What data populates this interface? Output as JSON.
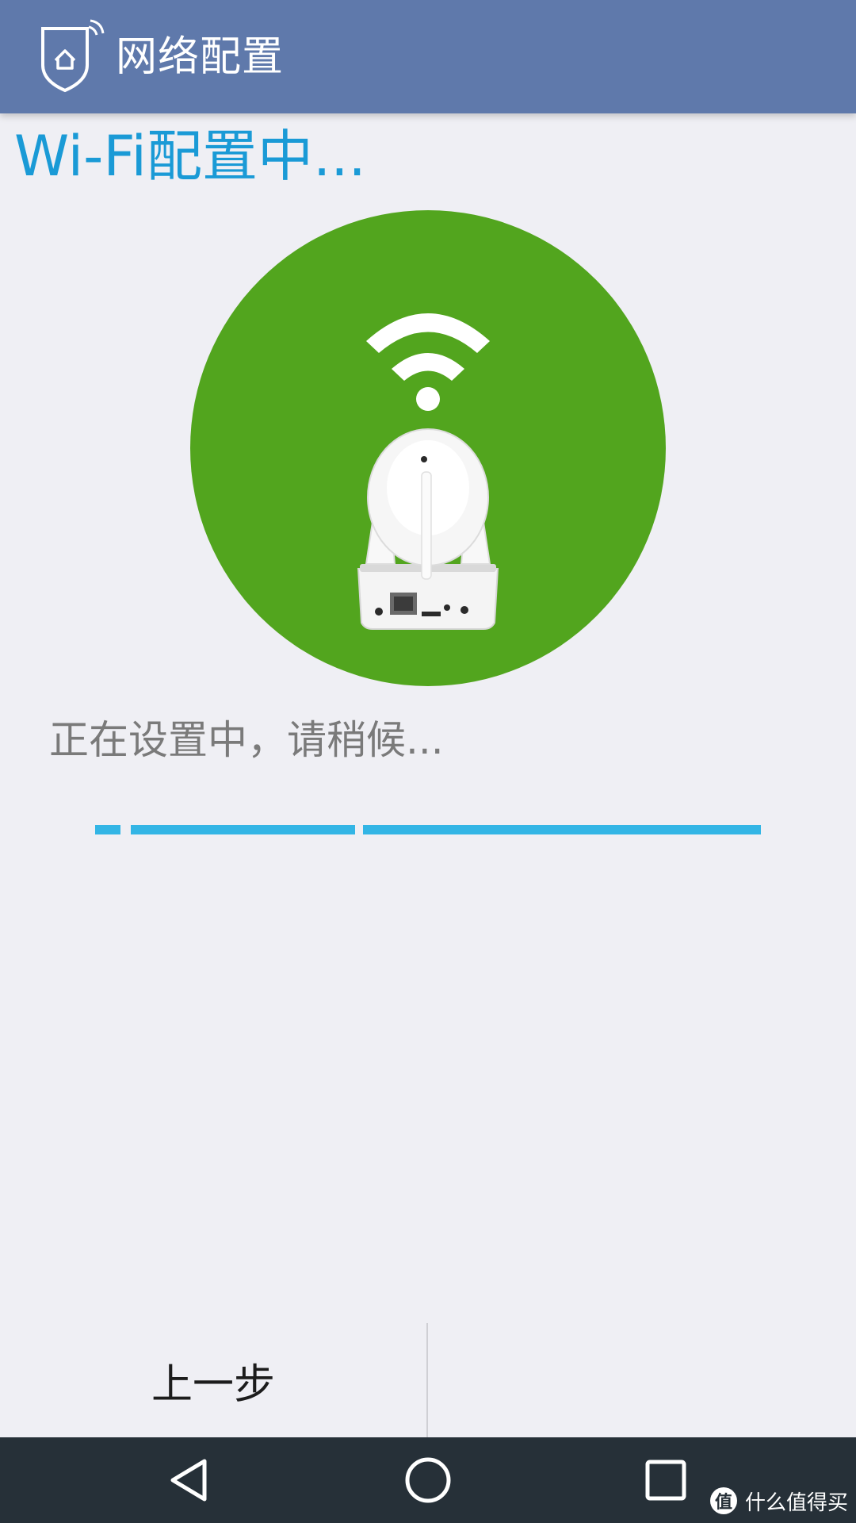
{
  "app_bar": {
    "title": "网络配置",
    "logo_icon": "home-shield-icon",
    "color": "#5f79ab"
  },
  "heading": "Wi-Fi配置中...",
  "illustration": {
    "circle_color": "#52a51e",
    "icons": [
      "wifi-icon",
      "ip-camera-icon"
    ]
  },
  "status": "正在设置中，请稍候...",
  "progress": {
    "color": "#33b5e5",
    "segments": 3
  },
  "actions": {
    "prev_label": "上一步",
    "next_label": ""
  },
  "navbar": {
    "back_icon": "back-triangle-icon",
    "home_icon": "home-circle-icon",
    "recents_icon": "recents-square-icon"
  },
  "watermark": {
    "badge": "值",
    "text": "什么值得买"
  }
}
